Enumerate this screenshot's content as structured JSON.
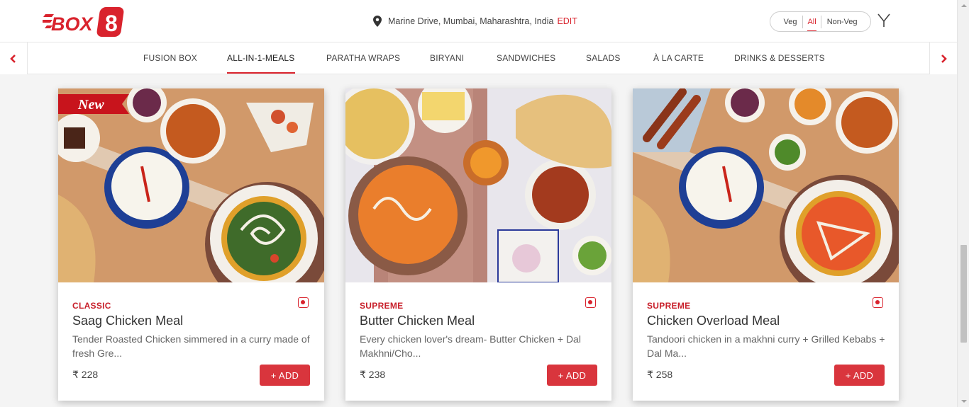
{
  "brand": {
    "logo_text": "BOX8",
    "accent": "#d9232d"
  },
  "location": {
    "address": "Marine Drive, Mumbai, Maharashtra, India",
    "edit_label": "EDIT"
  },
  "diet_toggle": {
    "options": [
      "Veg",
      "All",
      "Non-Veg"
    ],
    "selected": "All"
  },
  "categories": [
    {
      "label": "FUSION BOX"
    },
    {
      "label": "ALL-IN-1-MEALS",
      "active": true
    },
    {
      "label": "PARATHA WRAPS"
    },
    {
      "label": "BIRYANI"
    },
    {
      "label": "SANDWICHES"
    },
    {
      "label": "SALADS"
    },
    {
      "label": "À LA CARTE"
    },
    {
      "label": "DRINKS & DESSERTS"
    }
  ],
  "items": [
    {
      "badge": "New",
      "tier": "CLASSIC",
      "name": "Saag Chicken Meal",
      "description": "Tender Roasted Chicken simmered in a curry made of fresh Gre...",
      "price": "₹ 228",
      "add_label": "+ ADD",
      "main_curry_color": "#3f6b2a"
    },
    {
      "badge": "",
      "tier": "SUPREME",
      "name": "Butter Chicken Meal",
      "description": "Every chicken lover's dream- Butter Chicken + Dal Makhni/Cho...",
      "price": "₹ 238",
      "add_label": "+ ADD",
      "main_curry_color": "#e8762c"
    },
    {
      "badge": "",
      "tier": "SUPREME",
      "name": "Chicken Overload Meal",
      "description": "Tandoori chicken in a makhni curry + Grilled Kebabs + Dal Ma...",
      "price": "₹ 258",
      "add_label": "+ ADD",
      "main_curry_color": "#e8582a"
    }
  ]
}
